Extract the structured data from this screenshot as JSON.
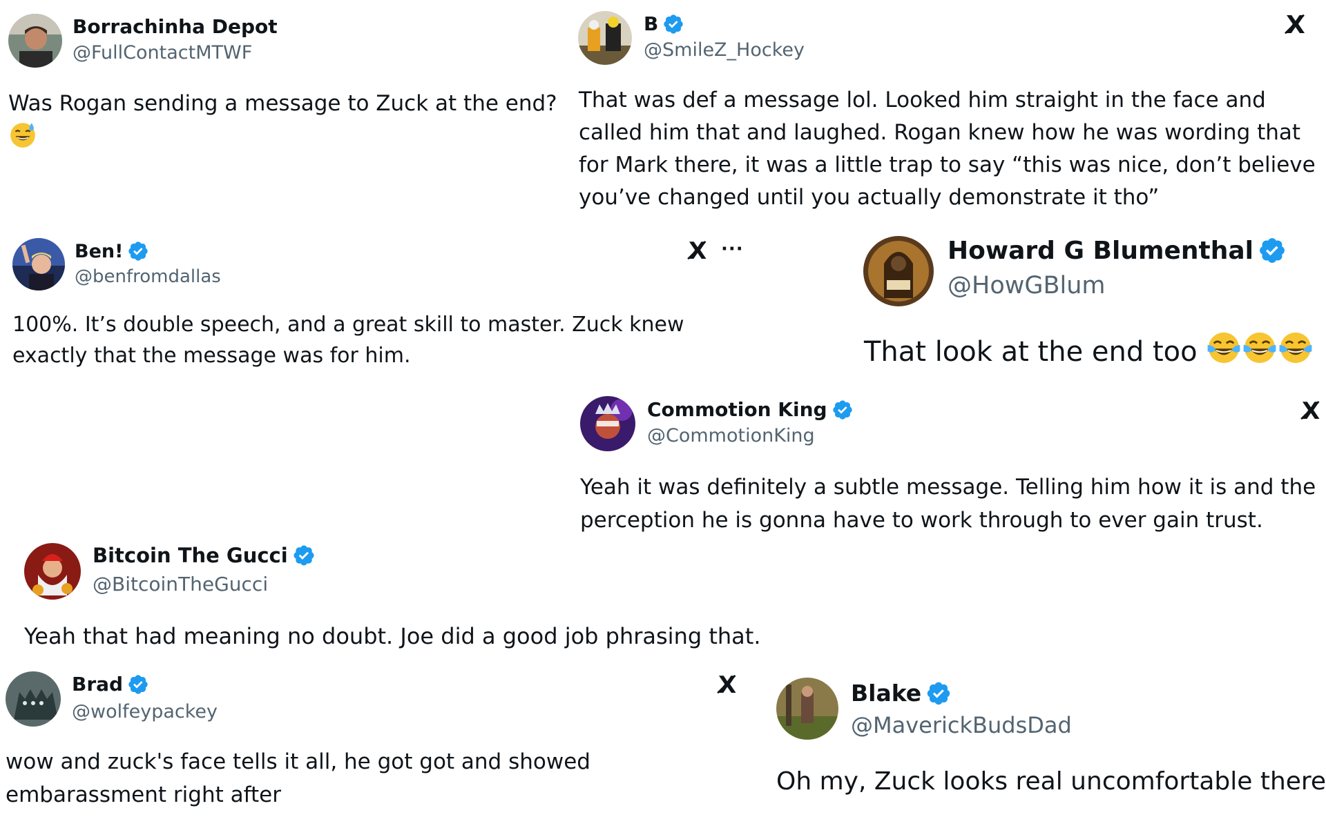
{
  "colors": {
    "verified": "#1d9bf0",
    "handle": "#536471",
    "text": "#0f1419",
    "emoji": "#f7c531"
  },
  "posts": [
    {
      "name": "Borrachinha Depot",
      "handle": "@FullContactMTWF",
      "verified": false,
      "text": "Was Rogan sending a message to Zuck at the end?",
      "emoji": "grinning-sweat-emoji"
    },
    {
      "name": "B",
      "handle": "@SmileZ_Hockey",
      "verified": true,
      "x_logo": "X̸",
      "text": "That was def a message lol. Looked him straight in the face and called him that and laughed. Rogan knew how he was wording that for Mark there, it was a little trap to say “this was nice, don’t believe you’ve changed until you actually demonstrate it tho”"
    },
    {
      "name": "Ben!",
      "handle": "@benfromdallas",
      "verified": true,
      "x_logo": "X̸",
      "more": "···",
      "text": "100%. It’s double speech, and a great skill to master. Zuck knew exactly that the message was for him."
    },
    {
      "name": "Howard G Blumenthal",
      "handle": "@HowGBlum",
      "verified": true,
      "text": "That look at the end too",
      "emoji": "tears-of-joy-emoji x3"
    },
    {
      "name": "Commotion King",
      "handle": "@CommotionKing",
      "verified": true,
      "x_logo": "X̸",
      "text": "Yeah it was definitely a subtle message. Telling him how it is and the perception he is gonna have to work through to ever gain trust."
    },
    {
      "name": "Bitcoin The Gucci",
      "handle": "@BitcoinTheGucci",
      "verified": true,
      "text": "Yeah that had meaning no doubt. Joe did a good job phrasing that."
    },
    {
      "name": "Brad",
      "handle": "@wolfeypackey",
      "verified": true,
      "x_logo": "X̸",
      "text": "wow and zuck's face tells it all, he got got and showed embarassment right after"
    },
    {
      "name": "Blake",
      "handle": "@MaverickBudsDad",
      "verified": true,
      "text": "Oh my, Zuck looks real uncomfortable there"
    }
  ]
}
